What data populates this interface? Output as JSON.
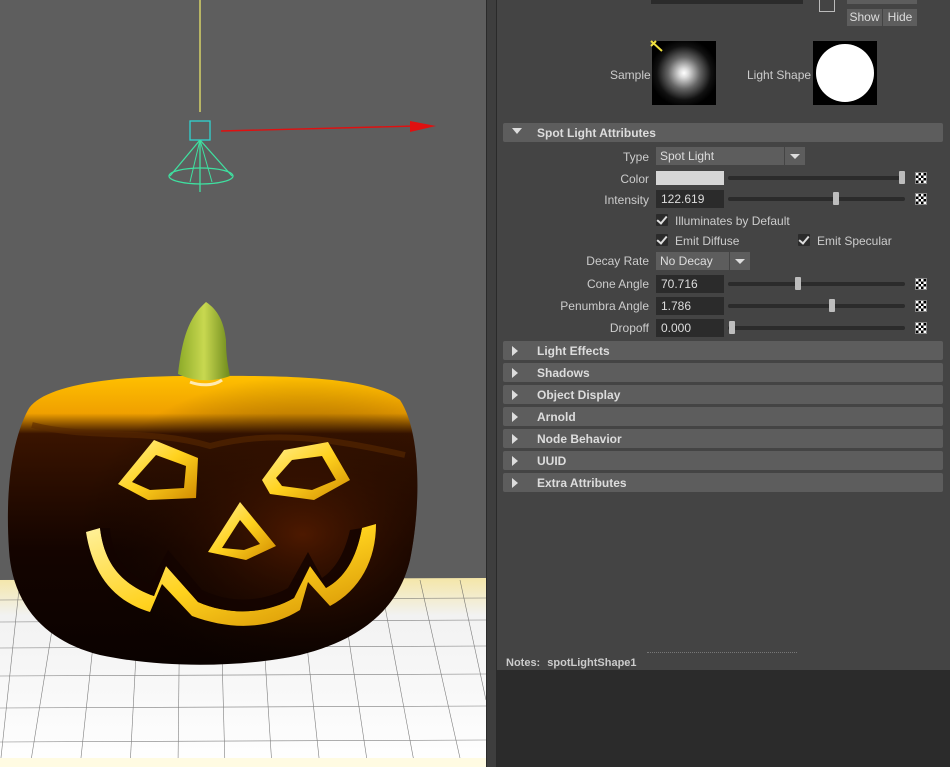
{
  "attribute_editor": {
    "show_label": "Show",
    "hide_label": "Hide",
    "sample_label": "Sample",
    "light_shape_label": "Light Shape",
    "spot_section": {
      "title": "Spot Light Attributes",
      "type_label": "Type",
      "type_value": "Spot Light",
      "color_label": "Color",
      "color_value": "#d6d6d6",
      "intensity_label": "Intensity",
      "intensity_value": "122.619",
      "illuminates_label": "Illuminates by Default",
      "emit_diffuse_label": "Emit Diffuse",
      "emit_specular_label": "Emit Specular",
      "decay_rate_label": "Decay Rate",
      "decay_rate_value": "No Decay",
      "cone_angle_label": "Cone Angle",
      "cone_angle_value": "70.716",
      "penumbra_label": "Penumbra Angle",
      "penumbra_value": "1.786",
      "dropoff_label": "Dropoff",
      "dropoff_value": "0.000"
    },
    "collapsed_sections": [
      "Light Effects",
      "Shadows",
      "Object Display",
      "Arnold",
      "Node Behavior",
      "UUID",
      "Extra Attributes"
    ],
    "notes_label": "Notes:",
    "notes_node": "spotLightShape1"
  },
  "colors": {
    "panel_bg": "#444444",
    "viewport_bg": "#5e5e5e",
    "field_bg": "#2b2b2b",
    "header_bg": "#5d5d5d",
    "pumpkin_glow": "#ffd21e"
  }
}
